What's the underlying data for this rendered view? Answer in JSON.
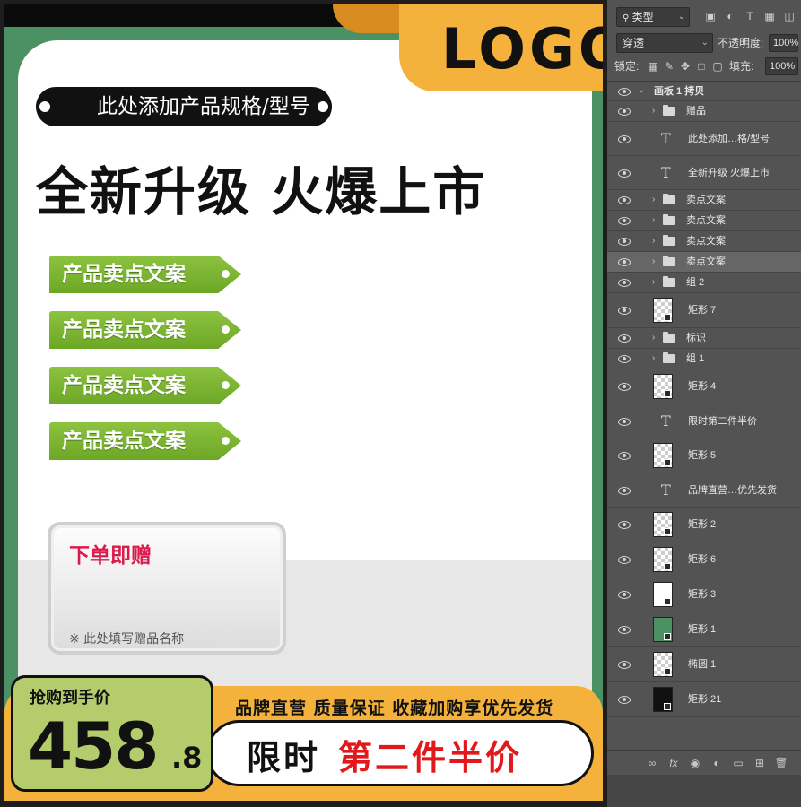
{
  "design": {
    "logo": "LOGO",
    "spec_tag": "此处添加产品规格/型号",
    "headline": "全新升级 火爆上市",
    "selling_points": [
      "产品卖点文案",
      "产品卖点文案",
      "产品卖点文案",
      "产品卖点文案"
    ],
    "gift": {
      "title": "下单即赠",
      "note": "※ 此处填写赠品名称"
    },
    "price": {
      "label": "抢购到手价",
      "main": "458",
      "decimal": ".8"
    },
    "slogan": "品牌直营 质量保证 收藏加购享优先发货",
    "promo": {
      "part1": "限时",
      "part2": "第二件半价"
    },
    "colors": {
      "green": "#4b9163",
      "orange": "#f4b23c",
      "lime": "#b5cc6c",
      "red": "#e1181c",
      "pink": "#d91c4c"
    }
  },
  "panel": {
    "kind_filter": "类型",
    "blend_mode": "穿透",
    "opacity_label": "不透明度:",
    "opacity_value": "100%",
    "lock_label": "锁定:",
    "fill_label": "填充:",
    "fill_value": "100%",
    "artboard": "画板 1 拷贝",
    "layers": [
      {
        "name": "赠品",
        "type": "group"
      },
      {
        "name": "此处添加…格/型号",
        "type": "text"
      },
      {
        "name": "全新升级 火爆上市",
        "type": "text"
      },
      {
        "name": "卖点文案",
        "type": "group"
      },
      {
        "name": "卖点文案",
        "type": "group"
      },
      {
        "name": "卖点文案",
        "type": "group"
      },
      {
        "name": "卖点文案",
        "type": "group",
        "selected": true
      },
      {
        "name": "组 2",
        "type": "group"
      },
      {
        "name": "矩形 7",
        "type": "shape"
      },
      {
        "name": "标识",
        "type": "group"
      },
      {
        "name": "组 1",
        "type": "group"
      },
      {
        "name": "矩形 4",
        "type": "shape"
      },
      {
        "name": "限时第二件半价",
        "type": "text"
      },
      {
        "name": "矩形 5",
        "type": "shape"
      },
      {
        "name": "品牌直营…优先发货",
        "type": "text"
      },
      {
        "name": "矩形 2",
        "type": "shape"
      },
      {
        "name": "矩形 6",
        "type": "shape"
      },
      {
        "name": "矩形 3",
        "type": "shape"
      },
      {
        "name": "矩形 1",
        "type": "shape"
      },
      {
        "name": "椭圆 1",
        "type": "shape"
      },
      {
        "name": "矩形 21",
        "type": "shape"
      }
    ],
    "footer_icons": [
      "link-icon",
      "fx-icon",
      "mask-icon",
      "adjustment-icon",
      "new-group-icon",
      "new-layer-icon",
      "trash-icon"
    ]
  }
}
